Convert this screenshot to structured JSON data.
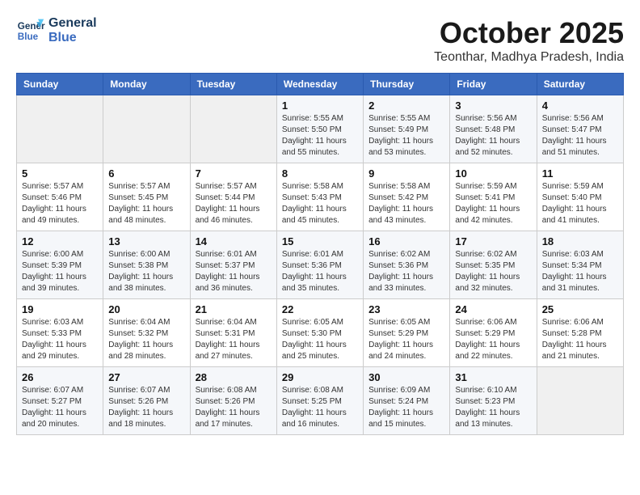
{
  "header": {
    "logo_line1": "General",
    "logo_line2": "Blue",
    "month": "October 2025",
    "location": "Teonthar, Madhya Pradesh, India"
  },
  "weekdays": [
    "Sunday",
    "Monday",
    "Tuesday",
    "Wednesday",
    "Thursday",
    "Friday",
    "Saturday"
  ],
  "weeks": [
    [
      {
        "day": "",
        "sunrise": "",
        "sunset": "",
        "daylight": ""
      },
      {
        "day": "",
        "sunrise": "",
        "sunset": "",
        "daylight": ""
      },
      {
        "day": "",
        "sunrise": "",
        "sunset": "",
        "daylight": ""
      },
      {
        "day": "1",
        "sunrise": "Sunrise: 5:55 AM",
        "sunset": "Sunset: 5:50 PM",
        "daylight": "Daylight: 11 hours and 55 minutes."
      },
      {
        "day": "2",
        "sunrise": "Sunrise: 5:55 AM",
        "sunset": "Sunset: 5:49 PM",
        "daylight": "Daylight: 11 hours and 53 minutes."
      },
      {
        "day": "3",
        "sunrise": "Sunrise: 5:56 AM",
        "sunset": "Sunset: 5:48 PM",
        "daylight": "Daylight: 11 hours and 52 minutes."
      },
      {
        "day": "4",
        "sunrise": "Sunrise: 5:56 AM",
        "sunset": "Sunset: 5:47 PM",
        "daylight": "Daylight: 11 hours and 51 minutes."
      }
    ],
    [
      {
        "day": "5",
        "sunrise": "Sunrise: 5:57 AM",
        "sunset": "Sunset: 5:46 PM",
        "daylight": "Daylight: 11 hours and 49 minutes."
      },
      {
        "day": "6",
        "sunrise": "Sunrise: 5:57 AM",
        "sunset": "Sunset: 5:45 PM",
        "daylight": "Daylight: 11 hours and 48 minutes."
      },
      {
        "day": "7",
        "sunrise": "Sunrise: 5:57 AM",
        "sunset": "Sunset: 5:44 PM",
        "daylight": "Daylight: 11 hours and 46 minutes."
      },
      {
        "day": "8",
        "sunrise": "Sunrise: 5:58 AM",
        "sunset": "Sunset: 5:43 PM",
        "daylight": "Daylight: 11 hours and 45 minutes."
      },
      {
        "day": "9",
        "sunrise": "Sunrise: 5:58 AM",
        "sunset": "Sunset: 5:42 PM",
        "daylight": "Daylight: 11 hours and 43 minutes."
      },
      {
        "day": "10",
        "sunrise": "Sunrise: 5:59 AM",
        "sunset": "Sunset: 5:41 PM",
        "daylight": "Daylight: 11 hours and 42 minutes."
      },
      {
        "day": "11",
        "sunrise": "Sunrise: 5:59 AM",
        "sunset": "Sunset: 5:40 PM",
        "daylight": "Daylight: 11 hours and 41 minutes."
      }
    ],
    [
      {
        "day": "12",
        "sunrise": "Sunrise: 6:00 AM",
        "sunset": "Sunset: 5:39 PM",
        "daylight": "Daylight: 11 hours and 39 minutes."
      },
      {
        "day": "13",
        "sunrise": "Sunrise: 6:00 AM",
        "sunset": "Sunset: 5:38 PM",
        "daylight": "Daylight: 11 hours and 38 minutes."
      },
      {
        "day": "14",
        "sunrise": "Sunrise: 6:01 AM",
        "sunset": "Sunset: 5:37 PM",
        "daylight": "Daylight: 11 hours and 36 minutes."
      },
      {
        "day": "15",
        "sunrise": "Sunrise: 6:01 AM",
        "sunset": "Sunset: 5:36 PM",
        "daylight": "Daylight: 11 hours and 35 minutes."
      },
      {
        "day": "16",
        "sunrise": "Sunrise: 6:02 AM",
        "sunset": "Sunset: 5:36 PM",
        "daylight": "Daylight: 11 hours and 33 minutes."
      },
      {
        "day": "17",
        "sunrise": "Sunrise: 6:02 AM",
        "sunset": "Sunset: 5:35 PM",
        "daylight": "Daylight: 11 hours and 32 minutes."
      },
      {
        "day": "18",
        "sunrise": "Sunrise: 6:03 AM",
        "sunset": "Sunset: 5:34 PM",
        "daylight": "Daylight: 11 hours and 31 minutes."
      }
    ],
    [
      {
        "day": "19",
        "sunrise": "Sunrise: 6:03 AM",
        "sunset": "Sunset: 5:33 PM",
        "daylight": "Daylight: 11 hours and 29 minutes."
      },
      {
        "day": "20",
        "sunrise": "Sunrise: 6:04 AM",
        "sunset": "Sunset: 5:32 PM",
        "daylight": "Daylight: 11 hours and 28 minutes."
      },
      {
        "day": "21",
        "sunrise": "Sunrise: 6:04 AM",
        "sunset": "Sunset: 5:31 PM",
        "daylight": "Daylight: 11 hours and 27 minutes."
      },
      {
        "day": "22",
        "sunrise": "Sunrise: 6:05 AM",
        "sunset": "Sunset: 5:30 PM",
        "daylight": "Daylight: 11 hours and 25 minutes."
      },
      {
        "day": "23",
        "sunrise": "Sunrise: 6:05 AM",
        "sunset": "Sunset: 5:29 PM",
        "daylight": "Daylight: 11 hours and 24 minutes."
      },
      {
        "day": "24",
        "sunrise": "Sunrise: 6:06 AM",
        "sunset": "Sunset: 5:29 PM",
        "daylight": "Daylight: 11 hours and 22 minutes."
      },
      {
        "day": "25",
        "sunrise": "Sunrise: 6:06 AM",
        "sunset": "Sunset: 5:28 PM",
        "daylight": "Daylight: 11 hours and 21 minutes."
      }
    ],
    [
      {
        "day": "26",
        "sunrise": "Sunrise: 6:07 AM",
        "sunset": "Sunset: 5:27 PM",
        "daylight": "Daylight: 11 hours and 20 minutes."
      },
      {
        "day": "27",
        "sunrise": "Sunrise: 6:07 AM",
        "sunset": "Sunset: 5:26 PM",
        "daylight": "Daylight: 11 hours and 18 minutes."
      },
      {
        "day": "28",
        "sunrise": "Sunrise: 6:08 AM",
        "sunset": "Sunset: 5:26 PM",
        "daylight": "Daylight: 11 hours and 17 minutes."
      },
      {
        "day": "29",
        "sunrise": "Sunrise: 6:08 AM",
        "sunset": "Sunset: 5:25 PM",
        "daylight": "Daylight: 11 hours and 16 minutes."
      },
      {
        "day": "30",
        "sunrise": "Sunrise: 6:09 AM",
        "sunset": "Sunset: 5:24 PM",
        "daylight": "Daylight: 11 hours and 15 minutes."
      },
      {
        "day": "31",
        "sunrise": "Sunrise: 6:10 AM",
        "sunset": "Sunset: 5:23 PM",
        "daylight": "Daylight: 11 hours and 13 minutes."
      },
      {
        "day": "",
        "sunrise": "",
        "sunset": "",
        "daylight": ""
      }
    ]
  ]
}
